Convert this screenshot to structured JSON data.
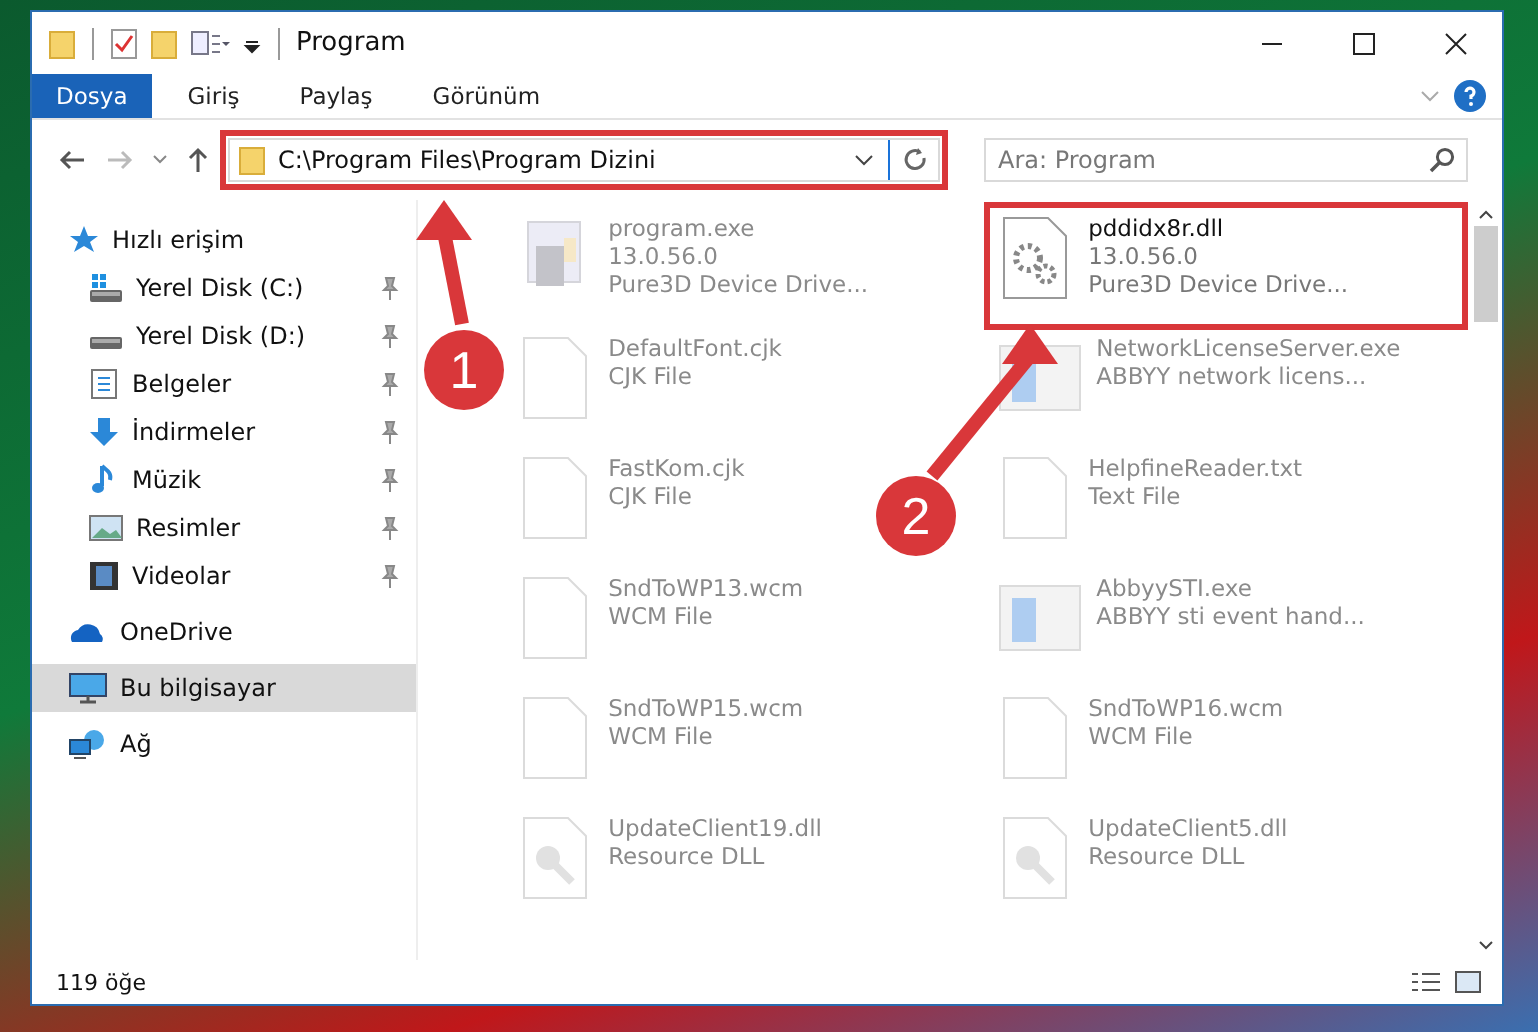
{
  "window": {
    "title": "Program"
  },
  "ribbon_tabs": [
    {
      "label": "Dosya",
      "selected": true
    },
    {
      "label": "Giriş",
      "selected": false
    },
    {
      "label": "Paylaş",
      "selected": false
    },
    {
      "label": "Görünüm",
      "selected": false
    }
  ],
  "address_bar": {
    "value": "C:\\Program Files\\Program Dizini",
    "highlighted": true
  },
  "search": {
    "placeholder": "Ara: Program"
  },
  "sidebar": {
    "items": [
      {
        "label": "Hızlı erişim",
        "selected": false,
        "children": [
          {
            "label": "Yerel Disk (C:)",
            "pinned": true,
            "selected": false
          },
          {
            "label": "Yerel Disk (D:)",
            "pinned": true,
            "selected": false
          },
          {
            "label": "Belgeler",
            "pinned": true,
            "selected": false
          },
          {
            "label": "İndirmeler",
            "pinned": true,
            "selected": false
          },
          {
            "label": "Müzik",
            "pinned": true,
            "selected": false
          },
          {
            "label": "Resimler",
            "pinned": true,
            "selected": false
          },
          {
            "label": "Videolar",
            "pinned": true,
            "selected": false
          }
        ]
      },
      {
        "label": "OneDrive",
        "selected": false
      },
      {
        "label": "Bu bilgisayar",
        "selected": true
      },
      {
        "label": "Ağ",
        "selected": false
      }
    ]
  },
  "files": [
    {
      "name": "program.exe",
      "lines": [
        "13.0.56.0",
        "Pure3D Device Drive..."
      ],
      "kind": "installer",
      "faded": true,
      "highlighted": false
    },
    {
      "name": "pddidx8r.dll",
      "lines": [
        "13.0.56.0",
        "Pure3D Device Drive..."
      ],
      "kind": "library",
      "faded": false,
      "highlighted": true
    },
    {
      "name": "DefaultFont.cjk",
      "lines": [
        "CJK File"
      ],
      "kind": "plain",
      "faded": true,
      "highlighted": false
    },
    {
      "name": "NetworkLicenseServer.exe",
      "lines": [
        "ABBYY network licens..."
      ],
      "kind": "application",
      "faded": true,
      "highlighted": false
    },
    {
      "name": "FastKom.cjk",
      "lines": [
        "CJK File"
      ],
      "kind": "plain",
      "faded": true,
      "highlighted": false
    },
    {
      "name": "HelpfineReader.txt",
      "lines": [
        "Text File"
      ],
      "kind": "plain",
      "faded": true,
      "highlighted": false
    },
    {
      "name": "SndToWP13.wcm",
      "lines": [
        "WCM File"
      ],
      "kind": "plain",
      "faded": true,
      "highlighted": false
    },
    {
      "name": "AbbyySTI.exe",
      "lines": [
        "ABBYY sti event hand..."
      ],
      "kind": "application",
      "faded": true,
      "highlighted": false
    },
    {
      "name": "SndToWP15.wcm",
      "lines": [
        "WCM File"
      ],
      "kind": "plain",
      "faded": true,
      "highlighted": false
    },
    {
      "name": "SndToWP16.wcm",
      "lines": [
        "WCM File"
      ],
      "kind": "plain",
      "faded": true,
      "highlighted": false
    },
    {
      "name": "UpdateClient19.dll",
      "lines": [
        "Resource DLL"
      ],
      "kind": "resource",
      "faded": true,
      "highlighted": false
    },
    {
      "name": "UpdateClient5.dll",
      "lines": [
        "Resource DLL"
      ],
      "kind": "resource",
      "faded": true,
      "highlighted": false
    }
  ],
  "status_bar": {
    "item_count": "119 öğe"
  },
  "callouts": [
    {
      "label": "1"
    },
    {
      "label": "2"
    }
  ]
}
